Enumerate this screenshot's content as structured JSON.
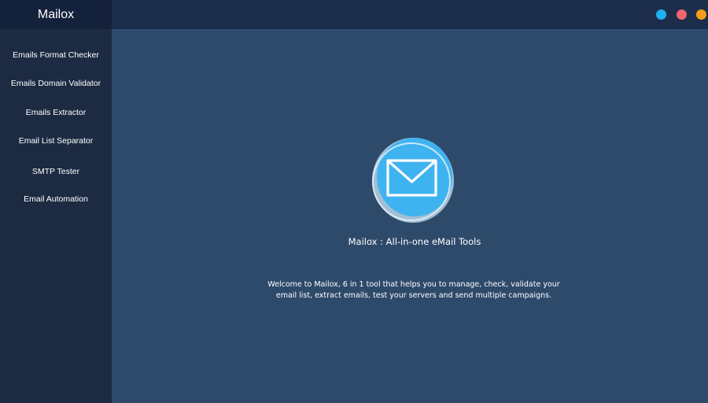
{
  "app": {
    "name": "Mailox"
  },
  "sidebar": {
    "items": [
      {
        "label": "Emails Format Checker"
      },
      {
        "label": "Emails Domain Validator"
      },
      {
        "label": "Emails Extractor"
      },
      {
        "label": "Email List Separator"
      },
      {
        "label": "SMTP Tester"
      },
      {
        "label": "Email Automation"
      }
    ]
  },
  "window_controls": [
    {
      "icon": "blue-dot-icon",
      "color": "#1fb0f0"
    },
    {
      "icon": "red-dot-icon",
      "color": "#f0646e"
    },
    {
      "icon": "orange-dot-icon",
      "color": "#f59e1b"
    }
  ],
  "main": {
    "logo_icon": "envelope-icon",
    "title": "Mailox : All-in-one eMail Tools",
    "description": "Welcome to Mailox, 6 in 1 tool that helps you to manage, check, validate your email list, extract emails, test your servers and send multiple campaigns."
  },
  "colors": {
    "sidebar_bg": "#1c2b42",
    "brand_bg": "#14213a",
    "topbar_bg": "#1b2d4b",
    "main_bg": "#2e4a6b",
    "logo_blue": "#3fb3f0"
  }
}
